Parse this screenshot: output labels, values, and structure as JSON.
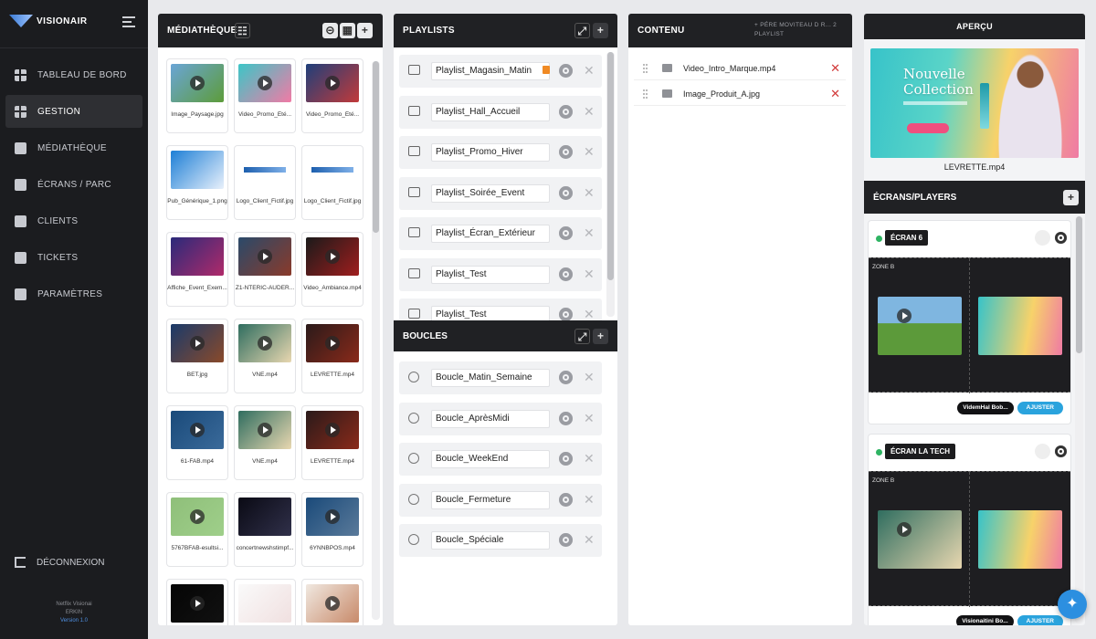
{
  "app": {
    "brand": "VISIONAIR",
    "footer_line1": "Netflix Visionai",
    "footer_line2": "ERKIN",
    "version": "Version 1.0"
  },
  "nav": [
    {
      "label": "TABLEAU DE BORD",
      "icon": "dashboard-icon"
    },
    {
      "label": "GESTION",
      "icon": "grid-icon",
      "active": true
    },
    {
      "label": "MÉDIATHÈQUE",
      "icon": "media-icon"
    },
    {
      "label": "ÉCRANS / PARC",
      "icon": "monitor-icon"
    },
    {
      "label": "CLIENTS",
      "icon": "users-icon"
    },
    {
      "label": "TICKETS",
      "icon": "ticket-icon"
    },
    {
      "label": "PARAMÈTRES",
      "icon": "gear-icon"
    }
  ],
  "logout_label": "DÉCONNEXION",
  "media": {
    "title": "MÉDIATHÈQUE",
    "items": [
      {
        "label": "Image_Paysage.jpg",
        "video": true,
        "c1": "#6aa5d6",
        "c2": "#5d9c3a"
      },
      {
        "label": "Video_Promo_Été...",
        "video": true,
        "c1": "#3cc6c7",
        "c2": "#f17aa5"
      },
      {
        "label": "Video_Promo_Été...",
        "video": true,
        "c1": "#1f3f7a",
        "c2": "#c23a3a"
      },
      {
        "label": "Pub_Générique_1.png",
        "video": false,
        "c1": "#1d7fd6",
        "c2": "#e8f0fb"
      },
      {
        "label": "Logo_Client_Fictif.jpg",
        "video": false,
        "c1": "#ffffff",
        "c2": "#ffffff",
        "logo": true
      },
      {
        "label": "Logo_Client_Fictif.jpg",
        "video": false,
        "c1": "#ffffff",
        "c2": "#ffffff",
        "logo": true
      },
      {
        "label": "Affiche_Event_Exem...",
        "video": false,
        "c1": "#2a2a7a",
        "c2": "#b02a6a"
      },
      {
        "label": "Z1-NTERIC-AUDER...",
        "video": true,
        "c1": "#2a4a6a",
        "c2": "#8a3a2a"
      },
      {
        "label": "Video_Ambiance.mp4",
        "video": true,
        "c1": "#1a1a1a",
        "c2": "#a01e1e"
      },
      {
        "label": "BET.jpg",
        "video": true,
        "c1": "#1a3a6a",
        "c2": "#8a4a2a"
      },
      {
        "label": "VNE.mp4",
        "video": true,
        "c1": "#2f6d5f",
        "c2": "#e8d7b0"
      },
      {
        "label": "LEVRETTE.mp4",
        "video": true,
        "c1": "#2a1a1a",
        "c2": "#8a2a1a"
      },
      {
        "label": "61-FAB.mp4",
        "video": true,
        "c1": "#1a4a7a",
        "c2": "#3a6a9a"
      },
      {
        "label": "VNE.mp4",
        "video": true,
        "c1": "#2f6d5f",
        "c2": "#e8d7b0"
      },
      {
        "label": "LEVRETTE.mp4",
        "video": true,
        "c1": "#2a1a1a",
        "c2": "#8a2a1a"
      },
      {
        "label": "5767BFAB-esultsi...",
        "video": true,
        "c1": "#8fbf7a",
        "c2": "#9fcf8a"
      },
      {
        "label": "concertnewshstimpf...",
        "video": false,
        "c1": "#0a0a14",
        "c2": "#30304a"
      },
      {
        "label": "6YNNBPOS.mp4",
        "video": true,
        "c1": "#1a4a7a",
        "c2": "#5a7a9a"
      },
      {
        "label": "",
        "video": true,
        "c1": "#050505",
        "c2": "#111111"
      },
      {
        "label": "",
        "video": false,
        "c1": "#fafafa",
        "c2": "#f0e0e0"
      },
      {
        "label": "",
        "video": true,
        "c1": "#f0e8e0",
        "c2": "#c88a6a"
      }
    ]
  },
  "playlists": {
    "title": "PLAYLISTS",
    "items": [
      {
        "name": "Playlist_Magasin_Matin",
        "locked": true
      },
      {
        "name": "Playlist_Hall_Accueil"
      },
      {
        "name": "Playlist_Promo_Hiver"
      },
      {
        "name": "Playlist_Soirée_Event"
      },
      {
        "name": "Playlist_Écran_Extérieur"
      },
      {
        "name": "Playlist_Test"
      },
      {
        "name": "Playlist_Test"
      }
    ]
  },
  "boucles": {
    "title": "BOUCLES",
    "items": [
      "Boucle_Matin_Semaine",
      "Boucle_AprèsMidi",
      "Boucle_WeekEnd",
      "Boucle_Fermeture",
      "Boucle_Spéciale"
    ]
  },
  "contenu": {
    "title": "CONTENU",
    "subtitle": "+ PÉRE MOVITEAU D R... 2 PLAYLIST",
    "items": [
      {
        "name": "Video_Intro_Marque.mp4",
        "icon": "video-icon"
      },
      {
        "name": "Image_Produit_A.jpg",
        "icon": "image-icon"
      }
    ]
  },
  "apercu": {
    "title": "APERÇU",
    "ad_title_1": "Nouvelle",
    "ad_title_2": "Collection",
    "filename": "LEVRETTE.mp4"
  },
  "ecrans": {
    "title": "ÉCRANS/PLAYERS",
    "players": [
      {
        "name": "ÉCRAN 6",
        "zone": "ZONE B",
        "pill": "VidemHal Bob...",
        "pill2": "AJUSTER"
      },
      {
        "name": "ÉCRAN LA TECH",
        "zone": "ZONE B",
        "pill": "Visionaitini Bo...",
        "pill2": "AJUSTER"
      }
    ]
  },
  "colors": {
    "accent": "#2c8fe0",
    "online": "#2fb463",
    "delete": "#d23a3a",
    "lock": "#f08a24"
  }
}
